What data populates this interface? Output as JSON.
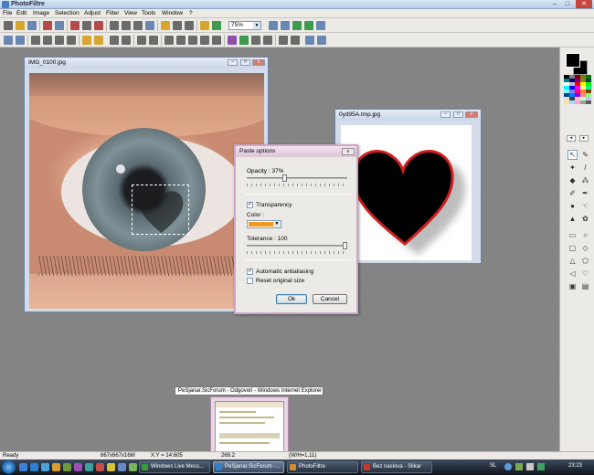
{
  "app": {
    "title": "PhotoFiltre"
  },
  "menu": [
    "File",
    "Edit",
    "Image",
    "Selection",
    "Adjust",
    "Filter",
    "View",
    "Tools",
    "Window",
    "?"
  ],
  "toolbar": {
    "zoom": "75%"
  },
  "windows": {
    "eye": {
      "title": "IMG_0100.jpg"
    },
    "heart": {
      "title": "0yd95A.tmp.jpg"
    }
  },
  "dialog": {
    "title": "Paste options",
    "opacity_label": "Opacity : 37%",
    "opacity_value": 37,
    "transparency_label": "Transparency",
    "transparency_checked": true,
    "color_label": "Color :",
    "color_value": "#f29a1c",
    "tolerance_label": "Tolerance : 100",
    "tolerance_value": 100,
    "antialiasing_label": "Automatic antialiasing",
    "antialiasing_checked": true,
    "reset_label": "Reset original size",
    "reset_checked": false,
    "ok_label": "Ok",
    "cancel_label": "Cancel"
  },
  "tooltip": "PeSjanar.SicForum - Odgovori - Windows Internet Explorer",
  "status": {
    "ready": "Ready",
    "size": "667x667x16M",
    "xy": "X:Y = 14:605",
    "info": "269.2",
    "extra": "(W/H=1,11)"
  },
  "taskbar": {
    "tasks": [
      {
        "label": "Windows Live Mess...",
        "active": false,
        "icon": "messenger-icon",
        "color": "#3a9a3a"
      },
      {
        "label": "PeSjanar.SicForum -...",
        "active": true,
        "icon": "internet-explorer-icon",
        "color": "#2f7fd0"
      },
      {
        "label": "PhotoFiltre",
        "active": false,
        "icon": "photofiltre-icon",
        "color": "#d08a2f"
      },
      {
        "label": "Bez naslova - Slikar",
        "active": false,
        "icon": "paint-icon",
        "color": "#c0392b"
      }
    ],
    "lang": "SL",
    "clock": "23:23"
  },
  "colors": {
    "foreground": "#000000",
    "background": "#000000"
  }
}
